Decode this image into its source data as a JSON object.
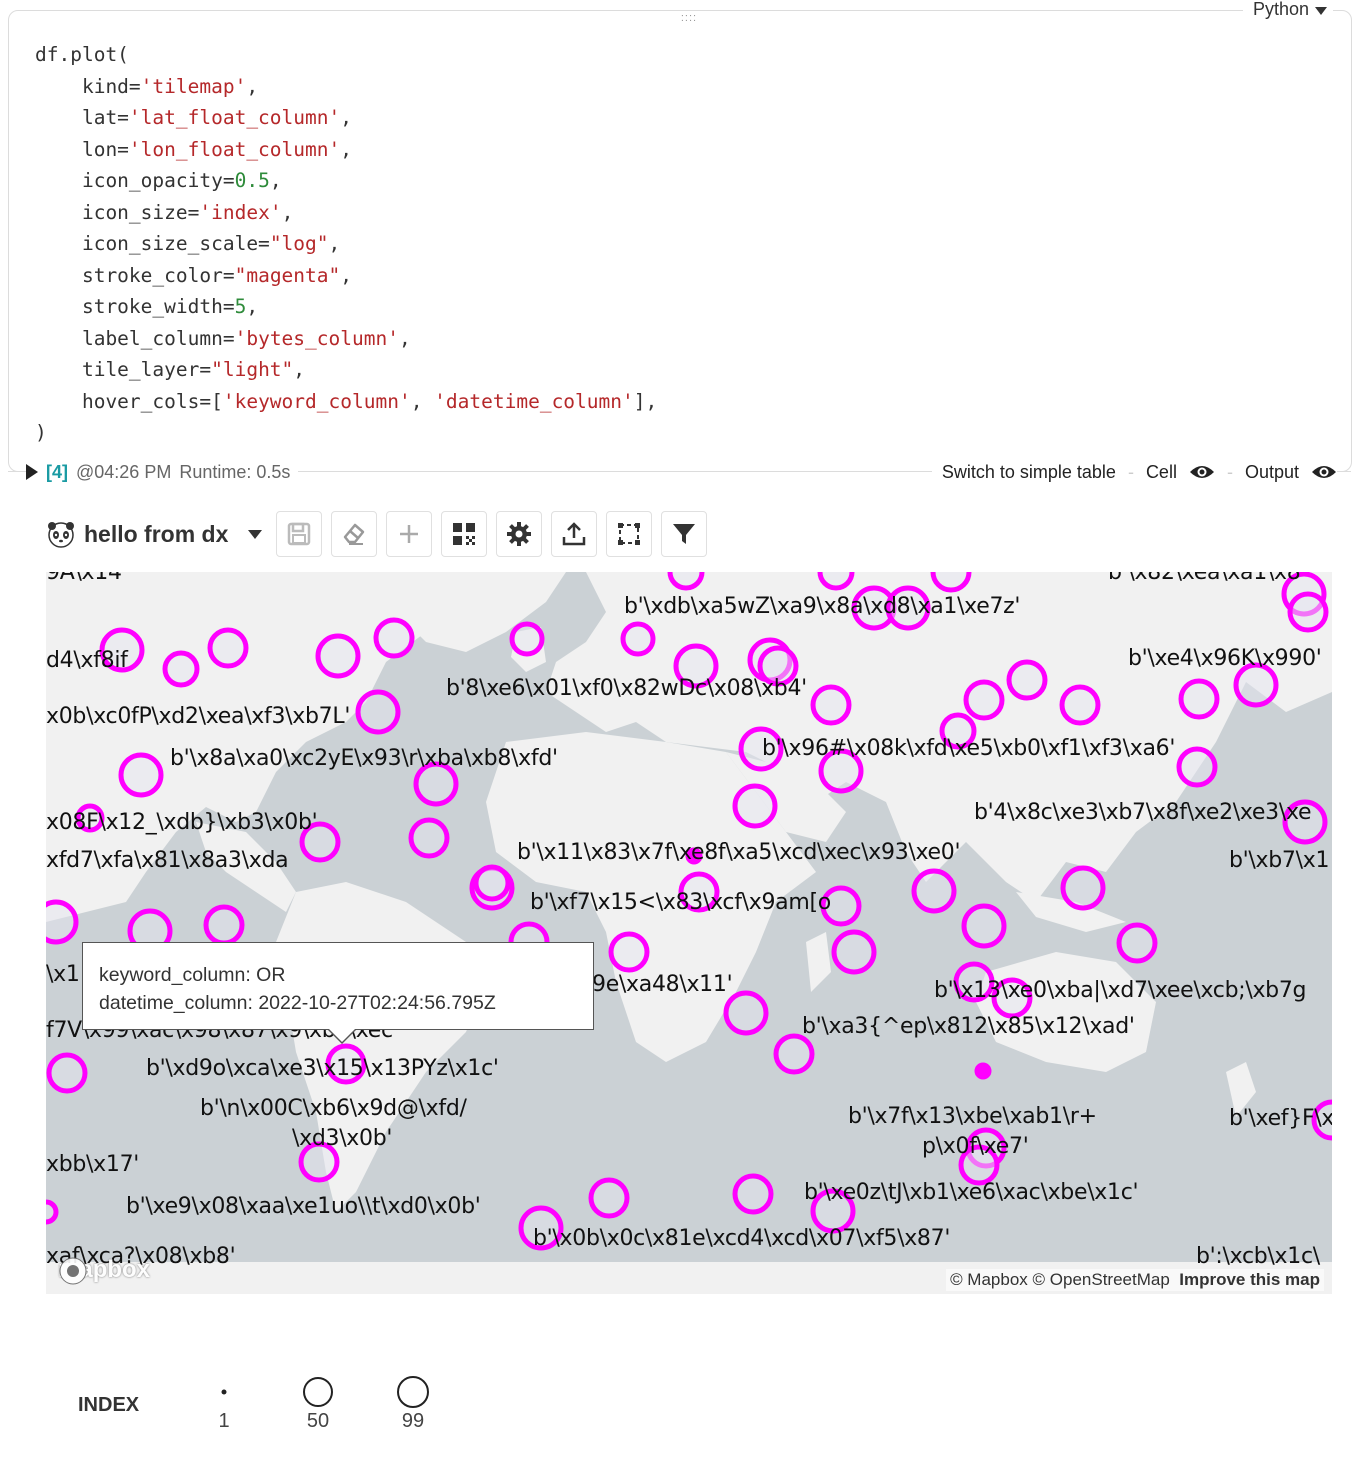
{
  "cell": {
    "language": "Python",
    "code_lines": [
      "df.plot(",
      "    kind='tilemap',",
      "    lat='lat_float_column',",
      "    lon='lon_float_column',",
      "    icon_opacity=0.5,",
      "    icon_size='index',",
      "    icon_size_scale=\"log\",",
      "    stroke_color=\"magenta\",",
      "    stroke_width=5,",
      "    label_column='bytes_column',",
      "    tile_layer=\"light\",",
      "    hover_cols=['keyword_column', 'datetime_column'],",
      ")"
    ]
  },
  "status": {
    "exec_count": "[4]",
    "timestamp": "@04:26 PM",
    "runtime": "Runtime: 0.5s",
    "switch_label": "Switch to simple table",
    "cell_label": "Cell",
    "output_label": "Output"
  },
  "toolbar": {
    "title": "hello from dx",
    "buttons": [
      "save-icon",
      "eraser-icon",
      "plus-icon",
      "qr-icon",
      "gear-icon",
      "upload-icon",
      "select-icon",
      "filter-icon"
    ]
  },
  "map": {
    "stroke_color": "#ff00ff",
    "labels": [
      "9A\\x14",
      "b'\\x82\\xea\\xa1\\x8",
      "b'\\xdb\\xa5wZ\\xa9\\x8a\\xd8\\xa1\\xe7z'",
      "d4\\xf8if",
      "b'\\xe4\\x96K\\x990'",
      "b'8\\xe6\\x01\\xf0\\x82wDc\\x08\\xb4'",
      "x0b\\xc0fP\\xd2\\xea\\xf3\\xb7L'",
      "b'\\x8a\\xa0\\xc2yE\\x93\\r\\xba\\xb8\\xfd'",
      "b'\\x96#\\x08k\\xfd\\xe5\\xb0\\xf1\\xf3\\xa6'",
      "b'4\\x8c\\xe3\\xb7\\x8f\\xe2\\xe3\\xe",
      "x08F\\x12_\\xdb}\\xb3\\x0b'",
      "xfd7\\xfa\\x81\\x8a3\\xda",
      "b'\\x11\\x83\\x7f\\xe8f\\xa5\\xcd\\xec\\x93\\xe0'",
      "b'\\xb7\\x1",
      "b'\\xf7\\x15<\\x83\\xcf\\x9am[o",
      "\\x1",
      "9e\\xa48\\x11'",
      "b'\\x13\\xe0\\xba|\\xd7\\xee\\xcb;\\xb7g",
      "f7V\\x99\\xac\\x98\\x87\\x9\\xbe\\xec",
      "b'\\xa3{^ep\\x812\\x85\\x12\\xad'",
      "b'\\xd9o\\xca\\xe3\\x15\\x13PYz\\x1c'",
      "b'\\n\\x00C\\xb6\\x9d@\\xfd/",
      "\\xd3\\x0b'",
      "b'\\x7f\\x13\\xbe\\xab1\\r+",
      "p\\x0f\\xe7'",
      "b'\\xef}F\\x",
      "xbb\\x17'",
      "b'\\xe9\\x08\\xaa\\xe1uo\\\\t\\xd0\\x0b'",
      "b'\\xe0z\\tJ\\xb1\\xe6\\xac\\xbe\\x1c'",
      "b'\\x0b\\x0c\\x81e\\xcd4\\xcd\\x07\\xf5\\x87'",
      "xaf\\xca?\\x08\\xb8'",
      "b':\\xcb\\x1c\\"
    ],
    "attribution": "© Mapbox © OpenStreetMap",
    "improve_link": "Improve this map",
    "logo_text": "mapbox"
  },
  "tooltip": {
    "line1": "keyword_column: OR",
    "line2": "datetime_column: 2022-10-27T02:24:56.795Z"
  },
  "legend": {
    "title": "INDEX",
    "items": [
      {
        "value": "1"
      },
      {
        "value": "50"
      },
      {
        "value": "99"
      }
    ]
  }
}
